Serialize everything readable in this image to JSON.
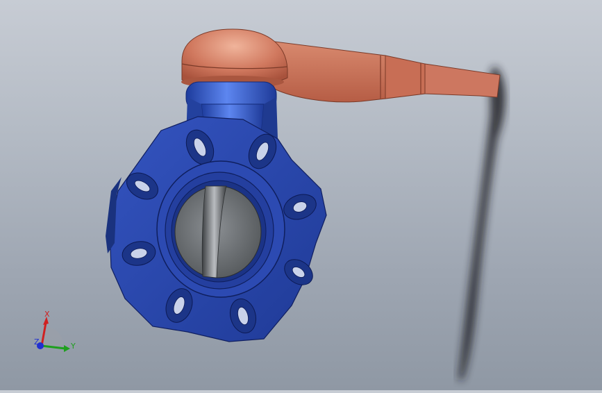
{
  "triad": {
    "x_label": "X",
    "y_label": "Y",
    "z_label": "Z"
  },
  "colors": {
    "body_blue": "#2a47a8",
    "handle_copper": "#c9725a",
    "disc_grey": "#6e7275",
    "stem_blue": "#2f54c4",
    "axis_x": "#d02020",
    "axis_y": "#1ea01e",
    "axis_z": "#2030d0"
  }
}
